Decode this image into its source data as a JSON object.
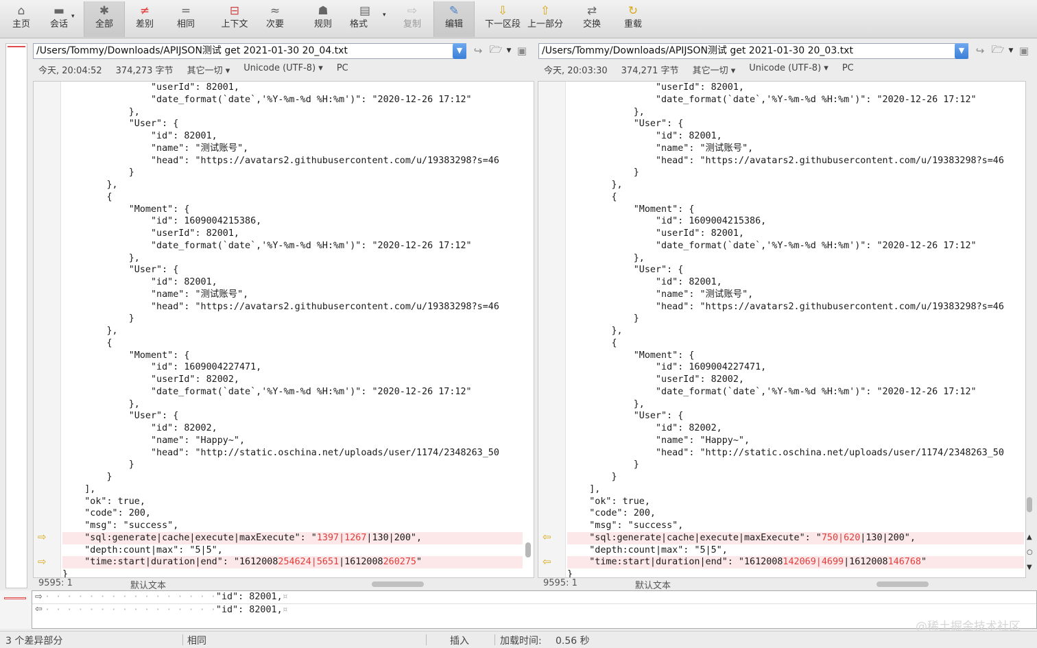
{
  "toolbar": {
    "items": [
      {
        "label": "主页",
        "icon": "home-icon"
      },
      {
        "label": "会话",
        "icon": "briefcase-icon"
      },
      {
        "label": "全部",
        "icon": "asterisk-icon"
      },
      {
        "label": "差别",
        "icon": "not-equal-icon"
      },
      {
        "label": "相同",
        "icon": "equal-icon"
      },
      {
        "label": "上下文",
        "icon": "context-icon"
      },
      {
        "label": "次要",
        "icon": "approx-icon"
      },
      {
        "label": "规则",
        "icon": "rules-icon"
      },
      {
        "label": "格式",
        "icon": "format-icon"
      },
      {
        "label": "复制",
        "icon": "copy-arrow-icon"
      },
      {
        "label": "编辑",
        "icon": "edit-icon"
      },
      {
        "label": "下一区段",
        "icon": "next-section-icon"
      },
      {
        "label": "上一部分",
        "icon": "prev-section-icon"
      },
      {
        "label": "交换",
        "icon": "swap-icon"
      },
      {
        "label": "重载",
        "icon": "reload-icon"
      }
    ]
  },
  "left": {
    "path": "/Users/Tommy/Downloads/APIJSON测试 get 2021-01-30 20_04.txt",
    "date": "今天, 20:04:52",
    "size": "374,273 字节",
    "filter": "其它一切",
    "encoding": "Unicode (UTF-8)",
    "lineend": "PC",
    "pos": "9595: 1",
    "syntax": "默认文本",
    "diff1": {
      "pre": "    \"sql:generate|cache|execute|maxExecute\": \"",
      "a": "1397",
      "sep": "|",
      "b": "1267",
      "post": "|130|200\","
    },
    "diff2": {
      "pre": "    \"time:start|duration|end\": \"1612008",
      "a": "254624",
      "sep1": "|",
      "b": "5651",
      "mid": "|1612008",
      "c": "260275",
      "post": "\""
    }
  },
  "right": {
    "path": "/Users/Tommy/Downloads/APIJSON测试 get 2021-01-30 20_03.txt",
    "date": "今天, 20:03:30",
    "size": "374,271 字节",
    "filter": "其它一切",
    "encoding": "Unicode (UTF-8)",
    "lineend": "PC",
    "pos": "9595: 1",
    "syntax": "默认文本",
    "diff1": {
      "pre": "    \"sql:generate|cache|execute|maxExecute\": \"",
      "a": "750",
      "sep": "|",
      "b": "620",
      "post": "|130|200\","
    },
    "diff2": {
      "pre": "    \"time:start|duration|end\": \"1612008",
      "a": "142069",
      "sep1": "|",
      "b": "4699",
      "mid": "|1612008",
      "c": "146768",
      "post": "\""
    }
  },
  "code_lines": [
    "                \"userId\": 82001,",
    "                \"date_format(`date`,'%Y-%m-%d %H:%m')\": \"2020-12-26 17:12\"",
    "            },",
    "            \"User\": {",
    "                \"id\": 82001,",
    "                \"name\": \"测试账号\",",
    "                \"head\": \"https://avatars2.githubusercontent.com/u/19383298?s=46",
    "            }",
    "        },",
    "        {",
    "            \"Moment\": {",
    "                \"id\": 1609004215386,",
    "                \"userId\": 82001,",
    "                \"date_format(`date`,'%Y-%m-%d %H:%m')\": \"2020-12-26 17:12\"",
    "            },",
    "            \"User\": {",
    "                \"id\": 82001,",
    "                \"name\": \"测试账号\",",
    "                \"head\": \"https://avatars2.githubusercontent.com/u/19383298?s=46",
    "            }",
    "        },",
    "        {",
    "            \"Moment\": {",
    "                \"id\": 1609004227471,",
    "                \"userId\": 82002,",
    "                \"date_format(`date`,'%Y-%m-%d %H:%m')\": \"2020-12-26 17:12\"",
    "            },",
    "            \"User\": {",
    "                \"id\": 82002,",
    "                \"name\": \"Happy~\",",
    "                \"head\": \"http://static.oschina.net/uploads/user/1174/2348263_50",
    "            }",
    "        }",
    "    ],",
    "    \"ok\": true,",
    "    \"code\": 200,",
    "    \"msg\": \"success\",",
    "__DIFF1__",
    "    \"depth:count|max\": \"5|5\",",
    "__DIFF2__",
    "}"
  ],
  "bottom_panel": {
    "line1": "\"id\": 82001,",
    "line2": "\"id\": 82001,",
    "eol": "¤"
  },
  "statusbar": {
    "diffs": "3 个差异部分",
    "same": "相同",
    "mode": "插入",
    "load_label": "加载时间:",
    "load_time": "0.56 秒"
  },
  "watermark": "@稀土掘金技术社区",
  "colors": {
    "diff_bg": "#fce8e8",
    "diff_text": "#e23b3b",
    "arrow": "#d9a915"
  }
}
